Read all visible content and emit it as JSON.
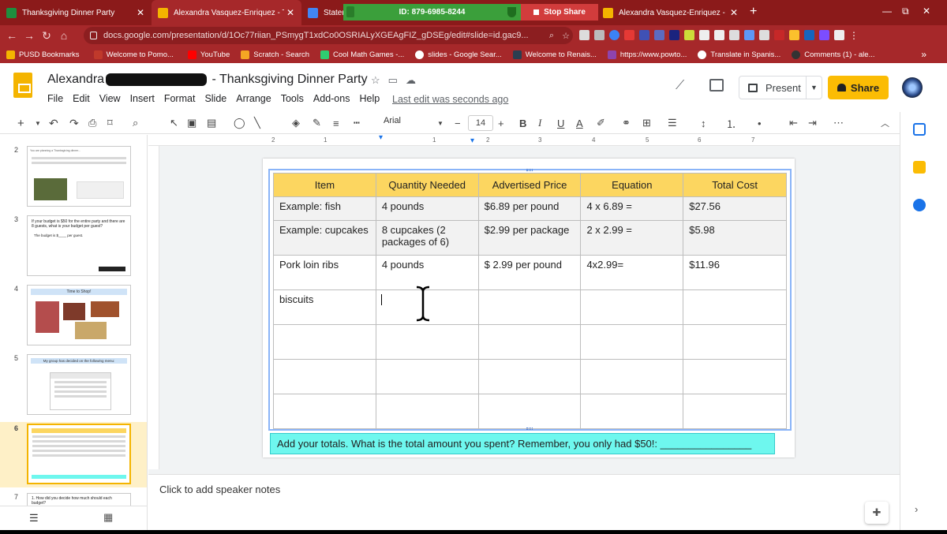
{
  "browser": {
    "tabs": [
      {
        "label": "Thanksgiving Dinner Party",
        "favicon_color": "#1e8e3e",
        "close": "✕"
      },
      {
        "label": "Alexandra Vasquez-Enriquez - T",
        "favicon_color": "#f4b400",
        "close": "✕"
      },
      {
        "label": "Stater",
        "favicon_color": "#4285f4",
        "close": ""
      },
      {
        "label": "Alexandra Vasquez-Enriquez - B",
        "favicon_color": "#f4b400",
        "close": "✕"
      }
    ],
    "zoom_meeting_id": "ID: 879-6985-8244",
    "stop_share_label": "Stop Share",
    "new_tab": "+",
    "window_controls": [
      "—",
      "⧉",
      "✕"
    ],
    "url": "docs.google.com/presentation/d/1Oc77riian_PSmygT1xdCo0OSRIALyXGEAgFIZ_gDSEg/edit#slide=id.gac9...",
    "bookmarks": [
      {
        "label": "PUSD Bookmarks",
        "color": "#f4b400"
      },
      {
        "label": "Welcome to Pomo...",
        "color": "#c0392b"
      },
      {
        "label": "YouTube",
        "color": "#ff0000"
      },
      {
        "label": "Scratch - Search",
        "color": "#f5a623"
      },
      {
        "label": "Cool Math Games -...",
        "color": "#2ecc71"
      },
      {
        "label": "slides - Google Sear...",
        "color": "#ffffff"
      },
      {
        "label": "Welcome to Renais...",
        "color": "#2c3e50"
      },
      {
        "label": "https://www.powto...",
        "color": "#8e44ad"
      },
      {
        "label": "Translate in Spanis...",
        "color": "#ffffff"
      },
      {
        "label": "Comments (1) - ale...",
        "color": "#333333"
      }
    ],
    "bookmarks_more": "»"
  },
  "doc": {
    "title_first": "Alexandra",
    "title_rest": " - Thanksgiving Dinner Party",
    "menu": [
      "File",
      "Edit",
      "View",
      "Insert",
      "Format",
      "Slide",
      "Arrange",
      "Tools",
      "Add-ons",
      "Help"
    ],
    "last_edit": "Last edit was seconds ago",
    "present_label": "Present",
    "share_label": "Share"
  },
  "toolbar": {
    "font": "Arial",
    "font_size": "14",
    "ruler_marks": [
      "2",
      "1",
      "1",
      "2",
      "3",
      "4",
      "5",
      "6",
      "7"
    ]
  },
  "thumbnails": [
    {
      "num": "2",
      "text": "You are planning a Thanksgiving dinner..."
    },
    {
      "num": "3",
      "text": "If your budget is $50 for the entire party and there are 8 guests, what is your budget per guest?",
      "sub": "The budget is $____ per guest."
    },
    {
      "num": "4",
      "text": "Time to Shop!"
    },
    {
      "num": "5",
      "text": "My group has decided on the following menu:"
    },
    {
      "num": "6",
      "text": ""
    },
    {
      "num": "7",
      "text": "1. How did you decide how much should each budget?"
    }
  ],
  "table": {
    "headers": [
      "Item",
      "Quantity Needed",
      "Advertised Price",
      "Equation",
      "Total Cost"
    ],
    "rows": [
      [
        "Example: fish",
        "4 pounds",
        "$6.89 per pound",
        "4 x 6.89 =",
        "$27.56"
      ],
      [
        "Example: cupcakes",
        "8 cupcakes (2 packages of 6)",
        "$2.99 per package",
        "2 x 2.99 =",
        "$5.98"
      ],
      [
        "Pork loin ribs",
        "4 pounds",
        "$ 2.99 per pound",
        "4x2.99=",
        "$11.96"
      ],
      [
        "biscuits",
        "",
        "",
        "",
        ""
      ],
      [
        "",
        "",
        "",
        "",
        ""
      ],
      [
        "",
        "",
        "",
        "",
        ""
      ],
      [
        "",
        "",
        "",
        "",
        ""
      ]
    ]
  },
  "footer_text": "Add your totals. What is the total amount you spent? Remember, you only had $50!:     ________________",
  "speaker_notes": "Click to add speaker notes"
}
